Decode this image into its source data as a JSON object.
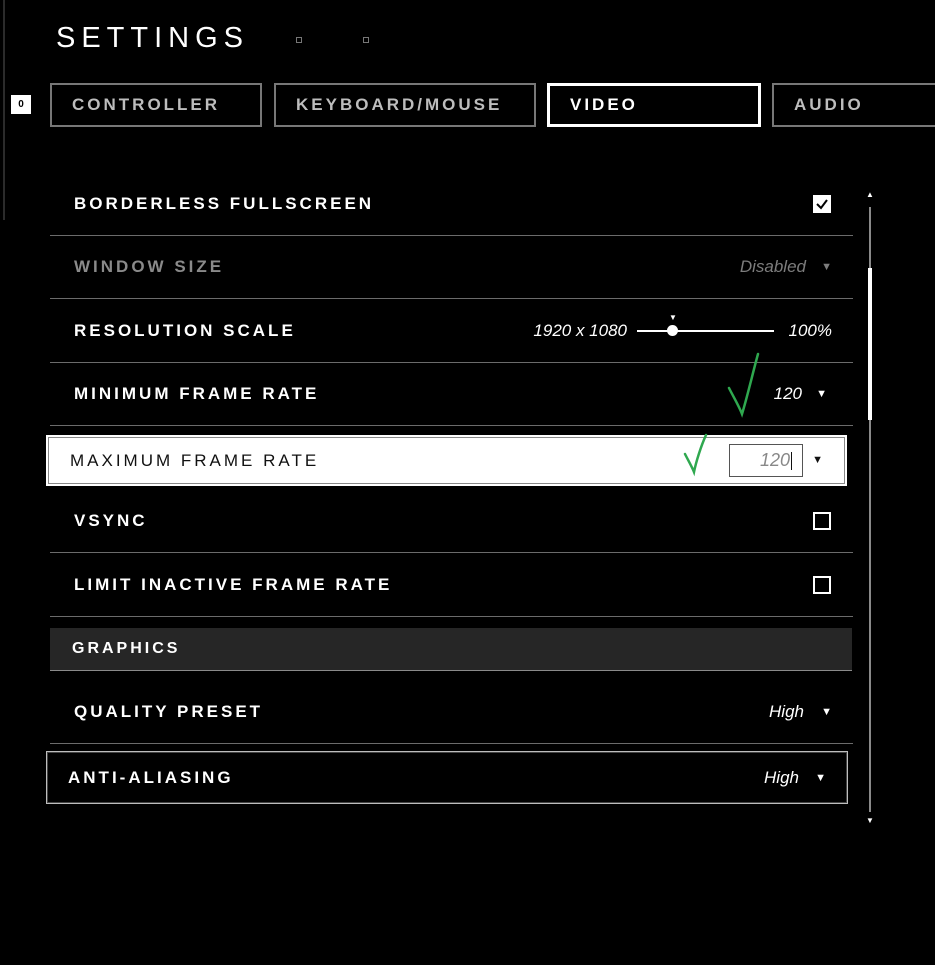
{
  "header": {
    "title": "SETTINGS",
    "left_bumper": "0"
  },
  "tabs": [
    {
      "label": "CONTROLLER",
      "active": false
    },
    {
      "label": "KEYBOARD/MOUSE",
      "active": false
    },
    {
      "label": "VIDEO",
      "active": true
    },
    {
      "label": "AUDIO",
      "active": false
    }
  ],
  "settings": {
    "borderless_fullscreen": {
      "label": "BORDERLESS FULLSCREEN",
      "checked": true
    },
    "window_size": {
      "label": "WINDOW SIZE",
      "value": "Disabled",
      "enabled": false
    },
    "resolution_scale": {
      "label": "RESOLUTION SCALE",
      "resolution": "1920 x 1080",
      "percent": "100%",
      "slider_fraction": 0.25
    },
    "minimum_frame_rate": {
      "label": "MINIMUM FRAME RATE",
      "value": "120"
    },
    "maximum_frame_rate": {
      "label": "MAXIMUM FRAME RATE",
      "value": "120"
    },
    "vsync": {
      "label": "VSYNC",
      "checked": false
    },
    "limit_inactive_frame_rate": {
      "label": "LIMIT INACTIVE FRAME RATE",
      "checked": false
    }
  },
  "graphics": {
    "section_label": "GRAPHICS",
    "quality_preset": {
      "label": "QUALITY PRESET",
      "value": "High"
    },
    "anti_aliasing": {
      "label": "ANTI-ALIASING",
      "value": "High"
    }
  },
  "colors": {
    "background": "#000000",
    "annotation_check": "#2fa84f",
    "highlight": "#ffffff"
  },
  "icons": [
    "checkmark-icon",
    "dropdown-arrow-icon",
    "scroll-up-icon",
    "scroll-down-icon"
  ]
}
